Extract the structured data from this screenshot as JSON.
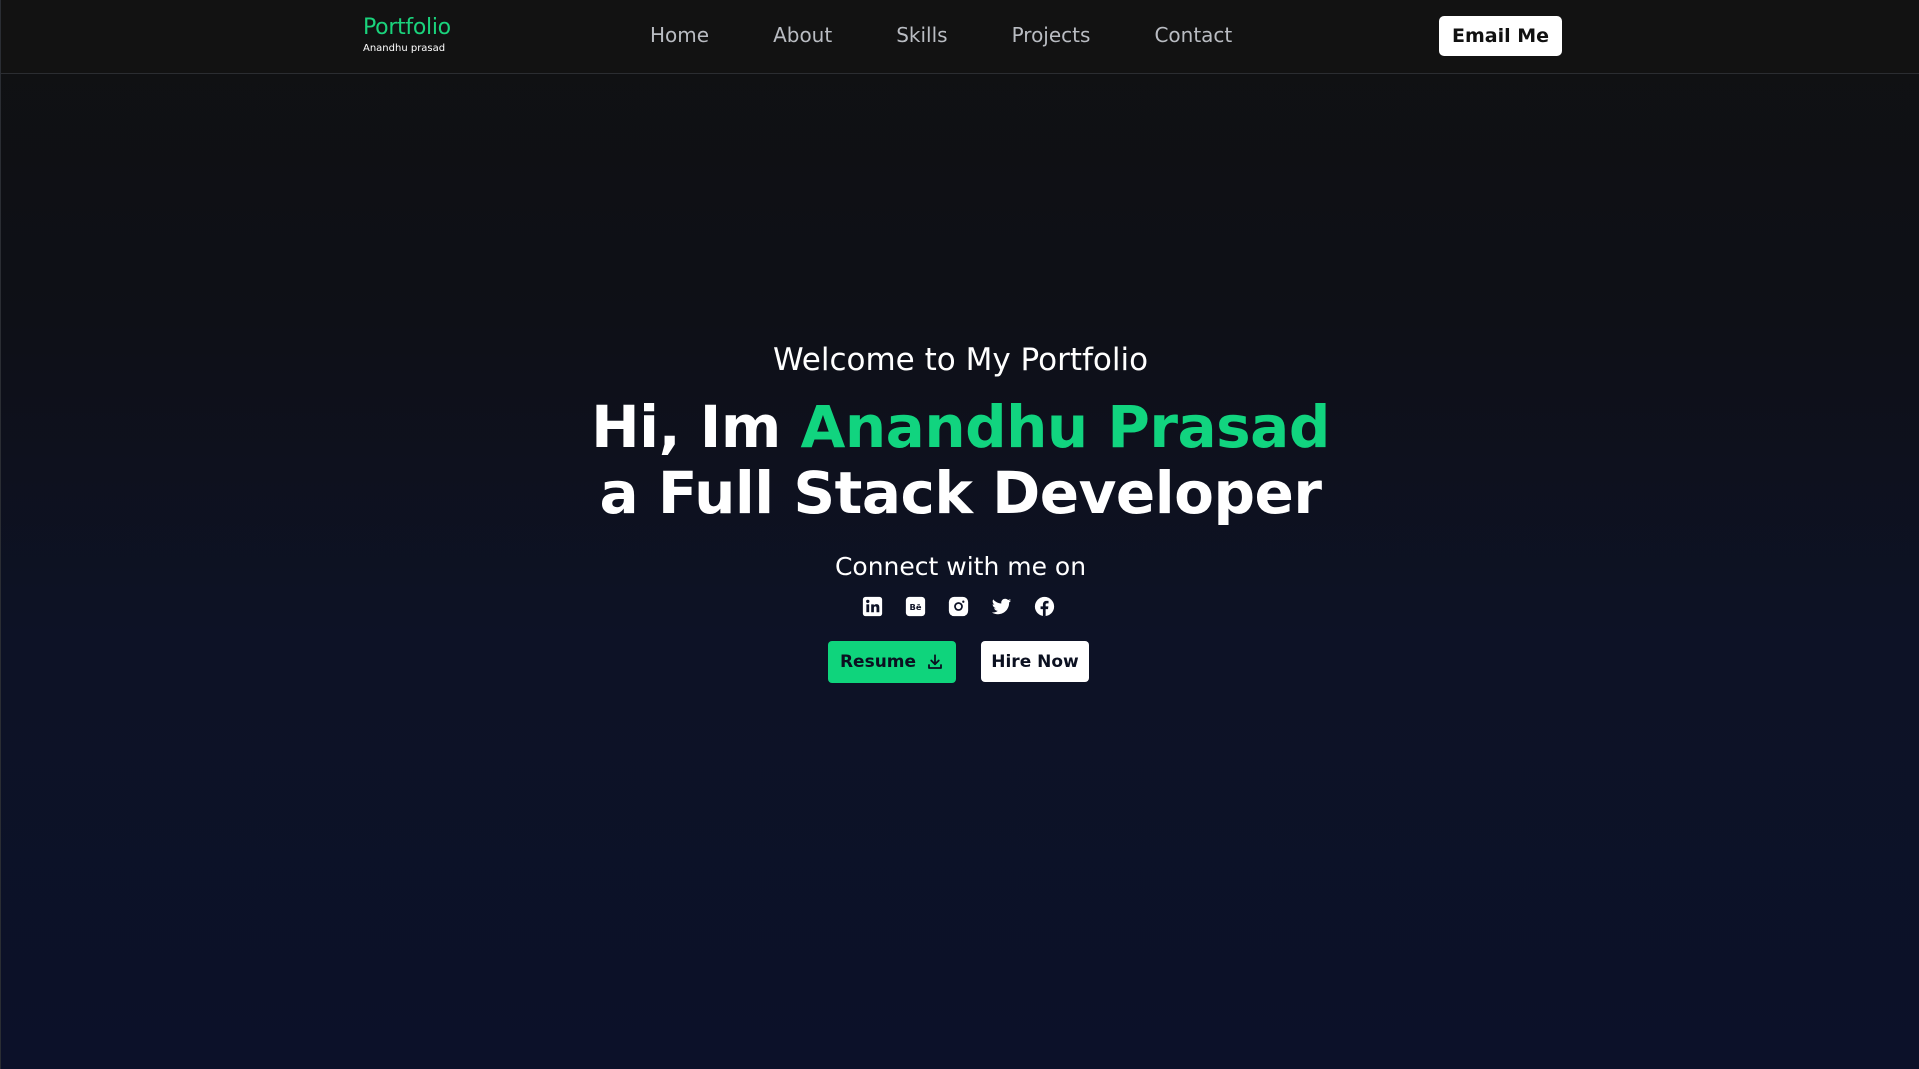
{
  "navbar": {
    "brand_title": "Portfolio",
    "brand_subtitle": "Anandhu prasad",
    "links": [
      "Home",
      "About",
      "Skills",
      "Projects",
      "Contact"
    ],
    "email_button": "Email Me"
  },
  "hero": {
    "welcome": "Welcome to My Portfolio",
    "greeting": "Hi, Im ",
    "name": "Anandhu Prasad",
    "role": "a Full Stack Developer",
    "connect_text": "Connect with me on",
    "socials": [
      "linkedin-icon",
      "behance-icon",
      "instagram-icon",
      "twitter-icon",
      "facebook-icon"
    ],
    "resume_button": "Resume",
    "hire_button": "Hire Now"
  },
  "colors": {
    "accent": "#11d47f",
    "nav_bg": "#121212",
    "page_bg": "#0c1129"
  }
}
